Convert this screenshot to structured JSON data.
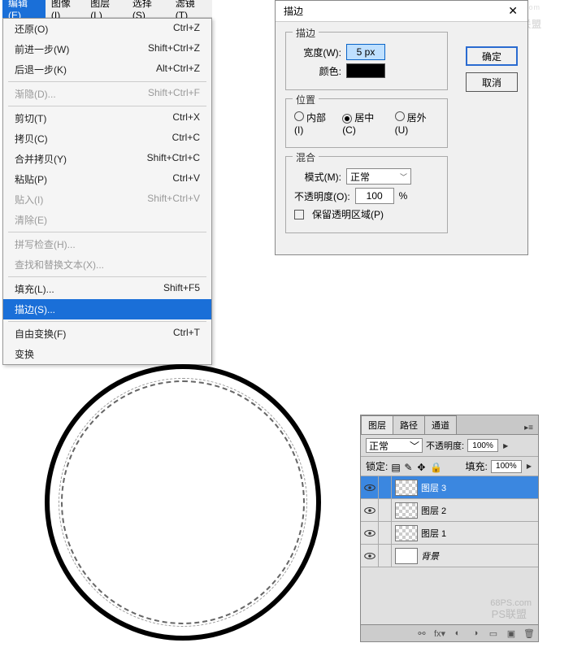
{
  "menubar": [
    "编辑(E)",
    "图像(I)",
    "图层(L)",
    "选择(S)",
    "滤镜(T)"
  ],
  "dropdown": [
    {
      "label": "还原(O)",
      "shortcut": "Ctrl+Z",
      "kind": "item"
    },
    {
      "label": "前进一步(W)",
      "shortcut": "Shift+Ctrl+Z",
      "kind": "item"
    },
    {
      "label": "后退一步(K)",
      "shortcut": "Alt+Ctrl+Z",
      "kind": "item"
    },
    {
      "kind": "sep"
    },
    {
      "label": "渐隐(D)...",
      "shortcut": "Shift+Ctrl+F",
      "kind": "disabled"
    },
    {
      "kind": "sep"
    },
    {
      "label": "剪切(T)",
      "shortcut": "Ctrl+X",
      "kind": "item"
    },
    {
      "label": "拷贝(C)",
      "shortcut": "Ctrl+C",
      "kind": "item"
    },
    {
      "label": "合并拷贝(Y)",
      "shortcut": "Shift+Ctrl+C",
      "kind": "item"
    },
    {
      "label": "粘贴(P)",
      "shortcut": "Ctrl+V",
      "kind": "item"
    },
    {
      "label": "贴入(I)",
      "shortcut": "Shift+Ctrl+V",
      "kind": "disabled"
    },
    {
      "label": "清除(E)",
      "shortcut": "",
      "kind": "disabled"
    },
    {
      "kind": "sep"
    },
    {
      "label": "拼写检查(H)...",
      "shortcut": "",
      "kind": "disabled"
    },
    {
      "label": "查找和替换文本(X)...",
      "shortcut": "",
      "kind": "disabled"
    },
    {
      "kind": "sep"
    },
    {
      "label": "填充(L)...",
      "shortcut": "Shift+F5",
      "kind": "item"
    },
    {
      "label": "描边(S)...",
      "shortcut": "",
      "kind": "sel"
    },
    {
      "kind": "sep"
    },
    {
      "label": "自由变换(F)",
      "shortcut": "Ctrl+T",
      "kind": "item"
    },
    {
      "label": "变换",
      "shortcut": "",
      "kind": "item"
    }
  ],
  "dialog": {
    "title": "描边",
    "ok": "确定",
    "cancel": "取消",
    "stroke_legend": "描边",
    "width_label": "宽度(W):",
    "width_value": "5 px",
    "color_label": "颜色:",
    "color": "#000000",
    "pos_legend": "位置",
    "pos_inside": "内部(I)",
    "pos_center": "居中(C)",
    "pos_outside": "居外(U)",
    "blend_legend": "混合",
    "mode_label": "模式(M):",
    "mode_value": "正常",
    "opacity_label": "不透明度(O):",
    "opacity_value": "100",
    "opacity_unit": "%",
    "preserve": "保留透明区域(P)"
  },
  "layers": {
    "tabs": [
      "图层",
      "路径",
      "通道"
    ],
    "blend": "正常",
    "opacity_label": "不透明度:",
    "opacity": "100%",
    "lock_label": "锁定:",
    "fill_label": "填充:",
    "fill": "100%",
    "rows": [
      {
        "name": "图层 3",
        "sel": true,
        "bg": false
      },
      {
        "name": "图层 2",
        "sel": false,
        "bg": false
      },
      {
        "name": "图层 1",
        "sel": false,
        "bg": false
      },
      {
        "name": "背景",
        "sel": false,
        "bg": true
      }
    ],
    "wm1": "68PS.com",
    "wm2": "PS联盟"
  },
  "watermark": {
    "text": "PS联盟",
    "sub": "68PS.com"
  }
}
